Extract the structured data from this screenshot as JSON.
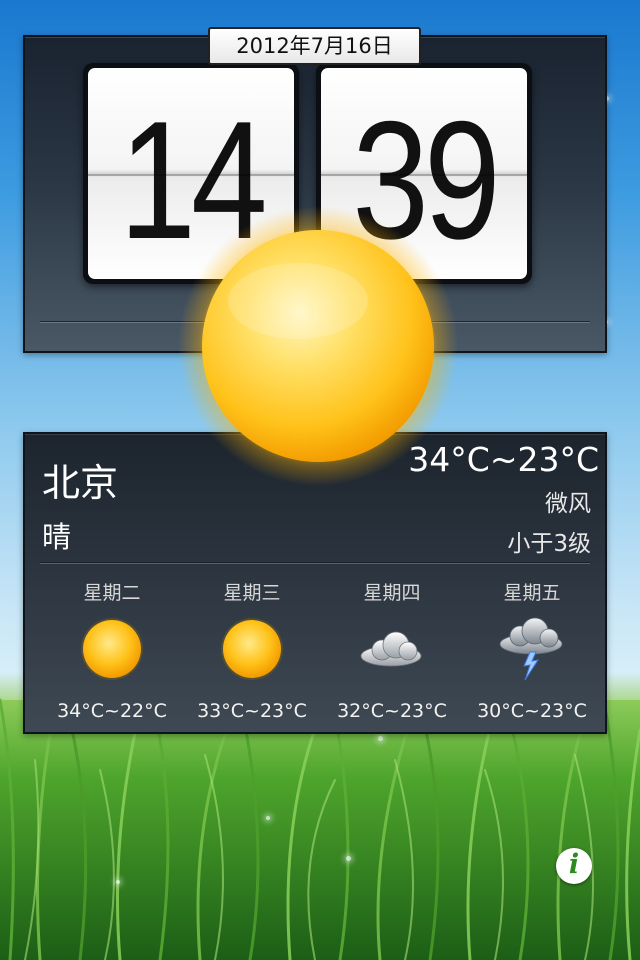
{
  "clock": {
    "date": "2012年7月16日",
    "hour": "14",
    "minute": "39"
  },
  "current": {
    "city": "北京",
    "condition": "晴",
    "temp_range": "34°C~23°C",
    "wind_direction": "微风",
    "wind_level": "小于3级",
    "icon": "sun-icon"
  },
  "forecast": [
    {
      "weekday": "星期二",
      "temp": "34°C~22°C",
      "icon": "sun-icon"
    },
    {
      "weekday": "星期三",
      "temp": "33°C~23°C",
      "icon": "sun-icon"
    },
    {
      "weekday": "星期四",
      "temp": "32°C~23°C",
      "icon": "cloud-icon"
    },
    {
      "weekday": "星期五",
      "temp": "30°C~23°C",
      "icon": "thunderstorm-icon"
    }
  ],
  "info_button": {
    "label": "i",
    "icon": "info-icon"
  },
  "colors": {
    "sky_top": "#1a78cf",
    "panel_dark": "#1c242d",
    "grass": "#3f9a24",
    "sun": "#ffc21a",
    "info_green": "#2c8a1e"
  }
}
